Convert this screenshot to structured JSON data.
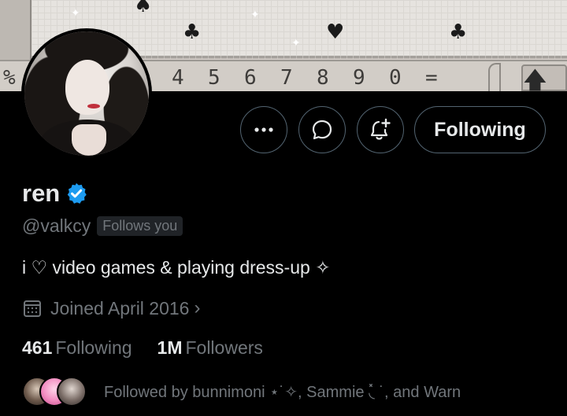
{
  "banner": {
    "keys": [
      "4",
      "5",
      "6",
      "7",
      "8",
      "9",
      "0",
      "="
    ],
    "suits": [
      "♠",
      "♣",
      "♥",
      "♣"
    ],
    "percent_key": "%",
    "uparrow": "🡅"
  },
  "profile": {
    "name": "ren",
    "handle": "@valkcy",
    "follows_you": "Follows you",
    "bio": "i ♡ video games & playing dress-up ✧",
    "joined": "Joined April 2016",
    "following_count": "461",
    "following_label": "Following",
    "followers_count": "1M",
    "followers_label": "Followers",
    "followed_by": "Followed by bunnimoni ⋆˙✧, Sammie ◟̽ ˙, and Warn"
  },
  "actions": {
    "more_icon": "more-icon",
    "message_icon": "message-icon",
    "notify_icon": "bell-plus-icon",
    "follow_label": "Following"
  },
  "colors": {
    "background": "#000000",
    "text_primary": "#e7e9ea",
    "text_secondary": "#71767b",
    "border": "#536471",
    "verified": "#1d9bf0"
  }
}
